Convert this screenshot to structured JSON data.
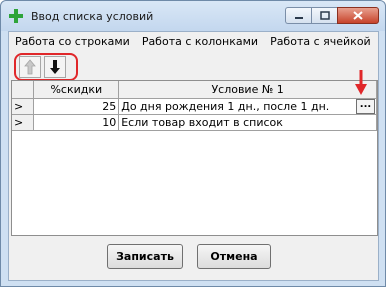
{
  "window": {
    "title": "Ввод списка условий"
  },
  "menu": [
    "Работа со строками",
    "Работа с колонками",
    "Работа с ячейкой"
  ],
  "toolbar": {
    "up_icon": "arrow-up-icon",
    "down_icon": "arrow-down-icon"
  },
  "grid": {
    "columns": [
      "",
      "%скидки",
      "Условие № 1"
    ],
    "rows": [
      {
        "indicator": ">",
        "discount": "25",
        "condition": "До дня рождения 1 дн., после 1 дн.",
        "button": "..."
      },
      {
        "indicator": ">",
        "discount": "10",
        "condition": "Если товар входит в список"
      }
    ]
  },
  "buttons": {
    "save": "Записать",
    "cancel": "Отмена"
  },
  "colors": {
    "annotation": "#e0272a",
    "title_bar": "#cfe0f2"
  }
}
